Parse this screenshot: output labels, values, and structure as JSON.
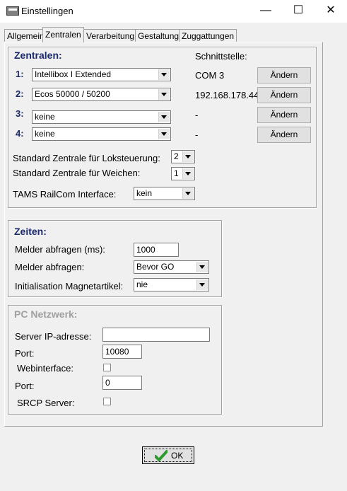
{
  "window": {
    "title": "Einstellingen",
    "minimize": "—",
    "maximize": "☐",
    "close": "✕"
  },
  "tabs": [
    {
      "label": "Allgemein"
    },
    {
      "label": "Zentralen"
    },
    {
      "label": "Verarbeitung"
    },
    {
      "label": "Gestaltung"
    },
    {
      "label": "Zuggattungen"
    }
  ],
  "zentralen": {
    "title": "Zentralen:",
    "schnittstelle_header": "Schnittstelle:",
    "rows": [
      {
        "num": "1:",
        "value": "Intellibox I Extended",
        "schnittstelle": "COM 3",
        "button": "Ändern"
      },
      {
        "num": "2:",
        "value": "Ecos 50000 / 50200",
        "schnittstelle": "192.168.178.44",
        "button": "Ändern"
      },
      {
        "num": "3:",
        "value": "keine",
        "schnittstelle": "-",
        "button": "Ändern"
      },
      {
        "num": "4:",
        "value": "keine",
        "schnittstelle": "-",
        "button": "Ändern"
      }
    ],
    "std_lok_label": "Standard Zentrale für Loksteuerung:",
    "std_lok_value": "2",
    "std_weichen_label": "Standard Zentrale für Weichen:",
    "std_weichen_value": "1",
    "railcom_label": "TAMS RailCom Interface:",
    "railcom_value": "kein"
  },
  "zeiten": {
    "title": "Zeiten:",
    "melder_ms_label": "Melder abfragen (ms):",
    "melder_ms_value": "1000",
    "melder_label": "Melder abfragen:",
    "melder_value": "Bevor GO",
    "init_label": "Initialisation Magnetartikel:",
    "init_value": "nie"
  },
  "netzwerk": {
    "title": "PC Netzwerk:",
    "server_ip_label": "Server IP-adresse:",
    "server_ip_value": "",
    "port1_label": "Port:",
    "port1_value": "10080",
    "webinterface_label": "Webinterface:",
    "port2_label": "Port:",
    "port2_value": "0",
    "srcp_label": "SRCP Server:"
  },
  "ok_label": "OK"
}
